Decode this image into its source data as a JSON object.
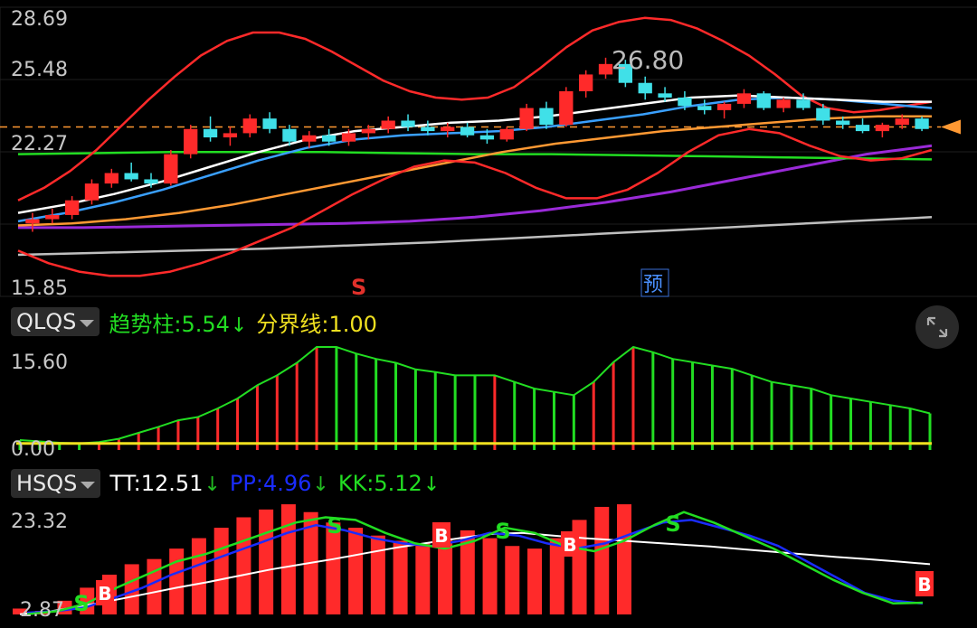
{
  "colors": {
    "up": "#ff2a2a",
    "down": "#40e0e8",
    "green": "#22dd22",
    "yellow": "#f0e020",
    "blue": "#1a2cff",
    "white": "#ffffff",
    "orange": "#ff9933",
    "purple": "#9a2ad8",
    "gray": "#bfbfbf",
    "label": "#c8c8c8"
  },
  "main": {
    "y_ticks": [
      "28.69",
      "25.48",
      "22.27",
      "15.85"
    ],
    "price_marker": "26.80",
    "dashed_level": 23.5,
    "markers": {
      "sell": "S",
      "forecast": "预"
    }
  },
  "qlqs": {
    "name": "QLQS",
    "trend_label": "趋势柱:",
    "trend_value": "5.54",
    "trend_arrow": "↓",
    "boundary_label": "分界线:",
    "boundary_value": "1.00",
    "y_ticks": [
      "15.60",
      "0.00"
    ]
  },
  "hsqs": {
    "name": "HSQS",
    "tt_label": "TT:",
    "tt_value": "12.51",
    "tt_arrow": "↓",
    "pp_label": "PP:",
    "pp_value": "4.96",
    "pp_arrow": "↓",
    "kk_label": "KK:",
    "kk_value": "5.12",
    "kk_arrow": "↓",
    "y_ticks": [
      "23.32",
      "2.87"
    ],
    "signal_buy": "B",
    "signal_sell": "S"
  },
  "chart_data": [
    {
      "type": "candlestick",
      "ylim": [
        15.85,
        28.69
      ],
      "candles": [
        [
          18.9,
          19.4,
          18.5,
          19.1
        ],
        [
          19.1,
          19.6,
          18.9,
          19.3
        ],
        [
          19.3,
          20.2,
          19.1,
          20.0
        ],
        [
          20.0,
          21.0,
          19.8,
          20.8
        ],
        [
          20.8,
          21.5,
          20.6,
          21.3
        ],
        [
          21.3,
          21.8,
          20.9,
          21.0
        ],
        [
          21.0,
          21.3,
          20.6,
          20.8
        ],
        [
          20.8,
          22.4,
          20.7,
          22.2
        ],
        [
          22.2,
          23.6,
          22.0,
          23.4
        ],
        [
          23.4,
          24.0,
          22.8,
          23.0
        ],
        [
          23.0,
          23.5,
          22.6,
          23.2
        ],
        [
          23.2,
          24.1,
          23.0,
          23.9
        ],
        [
          23.9,
          24.2,
          23.2,
          23.4
        ],
        [
          23.4,
          23.6,
          22.6,
          22.8
        ],
        [
          22.8,
          23.3,
          22.5,
          23.1
        ],
        [
          23.1,
          23.4,
          22.6,
          22.8
        ],
        [
          22.8,
          23.4,
          22.6,
          23.2
        ],
        [
          23.2,
          23.6,
          22.9,
          23.4
        ],
        [
          23.4,
          24.0,
          23.2,
          23.8
        ],
        [
          23.8,
          24.1,
          23.3,
          23.5
        ],
        [
          23.5,
          23.8,
          23.1,
          23.3
        ],
        [
          23.3,
          23.7,
          23.0,
          23.5
        ],
        [
          23.5,
          23.7,
          23.0,
          23.1
        ],
        [
          23.1,
          23.4,
          22.7,
          22.9
        ],
        [
          22.9,
          23.5,
          22.8,
          23.4
        ],
        [
          23.4,
          24.6,
          23.3,
          24.4
        ],
        [
          24.4,
          24.7,
          23.4,
          23.6
        ],
        [
          23.6,
          25.4,
          23.5,
          25.2
        ],
        [
          25.2,
          26.2,
          24.9,
          26.0
        ],
        [
          26.0,
          26.8,
          25.8,
          26.5
        ],
        [
          26.5,
          26.7,
          25.4,
          25.6
        ],
        [
          25.6,
          25.9,
          24.8,
          25.1
        ],
        [
          25.1,
          25.4,
          24.7,
          24.9
        ],
        [
          24.9,
          25.2,
          24.3,
          24.5
        ],
        [
          24.5,
          24.8,
          24.1,
          24.3
        ],
        [
          24.3,
          24.7,
          23.9,
          24.6
        ],
        [
          24.6,
          25.3,
          24.4,
          25.1
        ],
        [
          25.1,
          25.2,
          24.3,
          24.4
        ],
        [
          24.4,
          24.9,
          24.2,
          24.8
        ],
        [
          24.8,
          25.1,
          24.3,
          24.4
        ],
        [
          24.4,
          24.6,
          23.6,
          23.8
        ],
        [
          23.8,
          24.0,
          23.4,
          23.6
        ],
        [
          23.6,
          23.9,
          23.2,
          23.3
        ],
        [
          23.3,
          23.7,
          23.0,
          23.6
        ],
        [
          23.6,
          24.1,
          23.4,
          23.9
        ],
        [
          23.9,
          24.0,
          23.3,
          23.4
        ]
      ],
      "boll_upper": [
        20.0,
        20.6,
        21.4,
        22.4,
        23.6,
        24.8,
        25.9,
        26.9,
        27.6,
        28.0,
        28.0,
        27.7,
        27.1,
        26.4,
        25.7,
        25.2,
        24.9,
        24.8,
        24.9,
        25.4,
        26.3,
        27.3,
        28.1,
        28.5,
        28.7,
        28.6,
        28.2,
        27.6,
        26.9,
        26.0,
        25.0,
        24.4,
        24.2,
        24.3,
        24.5,
        24.7
      ],
      "boll_lower": [
        17.6,
        17.0,
        16.6,
        16.4,
        16.4,
        16.6,
        17.0,
        17.5,
        18.1,
        18.7,
        19.5,
        20.3,
        21.0,
        21.6,
        21.9,
        21.8,
        21.3,
        20.6,
        20.1,
        20.1,
        20.5,
        21.3,
        22.3,
        23.1,
        23.4,
        23.2,
        22.6,
        22.1,
        21.9,
        22.0,
        22.4
      ],
      "ma_white": [
        19.4,
        19.8,
        20.3,
        20.9,
        21.6,
        22.3,
        22.9,
        23.3,
        23.5,
        23.7,
        23.8,
        24.0,
        24.3,
        24.6,
        24.9,
        25.0,
        24.9,
        24.8,
        24.7,
        24.7
      ],
      "ma_blue": [
        19.0,
        19.4,
        19.9,
        20.5,
        21.2,
        21.9,
        22.5,
        22.9,
        23.1,
        23.2,
        23.3,
        23.5,
        23.8,
        24.1,
        24.5,
        24.8,
        24.9,
        24.8,
        24.6,
        24.4
      ],
      "ma_orange": [
        18.8,
        18.9,
        19.1,
        19.4,
        19.8,
        20.3,
        20.8,
        21.3,
        21.8,
        22.3,
        22.7,
        23.0,
        23.3,
        23.5,
        23.7,
        23.9,
        24.0,
        24.0
      ],
      "ma_green": [
        22.2,
        22.25,
        22.3,
        22.3,
        22.3,
        22.25,
        22.2,
        22.2,
        22.15,
        22.1,
        22.05,
        22.0,
        21.95
      ],
      "ma_purple": [
        18.7,
        18.7,
        18.75,
        18.8,
        18.85,
        18.9,
        19.0,
        19.2,
        19.5,
        19.9,
        20.4,
        21.0,
        21.6,
        22.2,
        22.6
      ],
      "ma_gray": [
        17.4,
        17.5,
        17.6,
        17.7,
        17.85,
        18.0,
        18.2,
        18.4,
        18.6,
        18.8,
        19.0,
        19.2
      ]
    },
    {
      "type": "bar",
      "title": "QLQS",
      "ylim": [
        0,
        15.6
      ],
      "values": [
        1.5,
        1.3,
        1.1,
        1.0,
        1.2,
        1.7,
        2.6,
        3.5,
        4.5,
        5.0,
        6.3,
        7.8,
        9.8,
        11.3,
        13.2,
        15.6,
        15.6,
        14.6,
        13.8,
        13.2,
        12.2,
        11.8,
        11.3,
        11.3,
        11.3,
        10.3,
        9.3,
        8.8,
        8.3,
        10.3,
        13.3,
        15.6,
        14.8,
        13.8,
        13.3,
        12.8,
        12.3,
        11.3,
        10.3,
        9.8,
        9.3,
        8.3,
        7.8,
        7.3,
        6.8,
        6.3,
        5.54
      ],
      "colors": [
        "g",
        "g",
        "g",
        "g",
        "r",
        "r",
        "r",
        "r",
        "r",
        "r",
        "r",
        "r",
        "r",
        "r",
        "r",
        "r",
        "g",
        "g",
        "g",
        "g",
        "g",
        "g",
        "g",
        "g",
        "r",
        "g",
        "g",
        "g",
        "g",
        "r",
        "r",
        "r",
        "g",
        "g",
        "g",
        "g",
        "g",
        "g",
        "g",
        "g",
        "g",
        "g",
        "g",
        "g",
        "g",
        "g",
        "g"
      ],
      "boundary": 1.0
    },
    {
      "type": "bar",
      "title": "HSQS",
      "ylim": [
        2.87,
        23.32
      ],
      "values": [
        4.0,
        3.0,
        5.5,
        8.0,
        10.5,
        12.5,
        13.5,
        15.5,
        17.5,
        19.5,
        21.5,
        23.0,
        24.0,
        22.5,
        20.5,
        19.5,
        18.0,
        17.0,
        16.5,
        17.5,
        19.0,
        17.5,
        16.0,
        15.5,
        17.5,
        21.0,
        23.5,
        24.0
      ],
      "tt": [
        2.9,
        3.5,
        4.5,
        5.6,
        6.8,
        8.0,
        9.1,
        10.3,
        11.5,
        12.5,
        13.5,
        14.6,
        15.7,
        16.6,
        17.5,
        18.3,
        18.5,
        18.0,
        17.5,
        17.1,
        16.7,
        16.3,
        15.9,
        15.4,
        14.9,
        14.4,
        13.9,
        13.5,
        13.0,
        12.51
      ],
      "pp": [
        3.2,
        3.5,
        4.2,
        6.0,
        8.0,
        10.5,
        12.5,
        14.5,
        16.5,
        18.5,
        20.0,
        19.0,
        17.5,
        16.5,
        16.0,
        17.0,
        18.5,
        18.0,
        16.5,
        15.5,
        16.5,
        18.5,
        20.5,
        21.0,
        19.5,
        18.0,
        16.0,
        13.0,
        10.0,
        7.0,
        5.5,
        4.96
      ],
      "kk": [
        2.9,
        3.5,
        5.0,
        8.0,
        10.5,
        13.0,
        14.5,
        16.5,
        18.5,
        20.5,
        21.5,
        21.0,
        18.5,
        16.5,
        15.5,
        17.0,
        19.5,
        18.5,
        16.0,
        15.0,
        17.0,
        20.0,
        22.5,
        20.5,
        18.0,
        15.5,
        12.5,
        9.5,
        7.0,
        5.0,
        5.12
      ]
    }
  ]
}
